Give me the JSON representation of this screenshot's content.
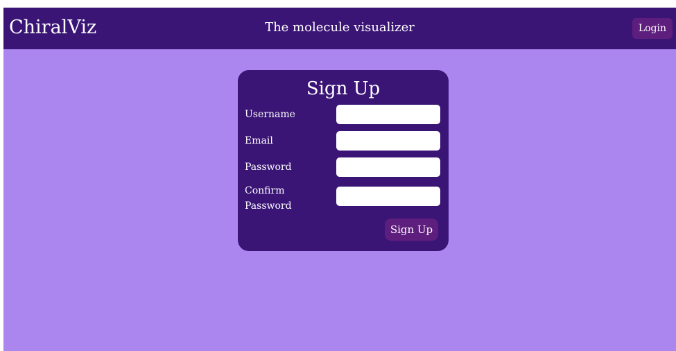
{
  "header": {
    "brand": "ChiralViz",
    "tagline": "The molecule visualizer",
    "login_label": "Login"
  },
  "signup": {
    "title": "Sign Up",
    "fields": [
      {
        "label": "Username",
        "value": "",
        "placeholder": ""
      },
      {
        "label": "Email",
        "value": "",
        "placeholder": ""
      },
      {
        "label": "Password",
        "value": "",
        "placeholder": ""
      },
      {
        "label": "Confirm Password",
        "value": "",
        "placeholder": ""
      }
    ],
    "submit_label": "Sign Up"
  },
  "colors": {
    "page_background": "#ab86ef",
    "navbar": "#3a1576",
    "card": "#3a1576",
    "button": "#5e1e7e",
    "text": "#ffffff"
  }
}
